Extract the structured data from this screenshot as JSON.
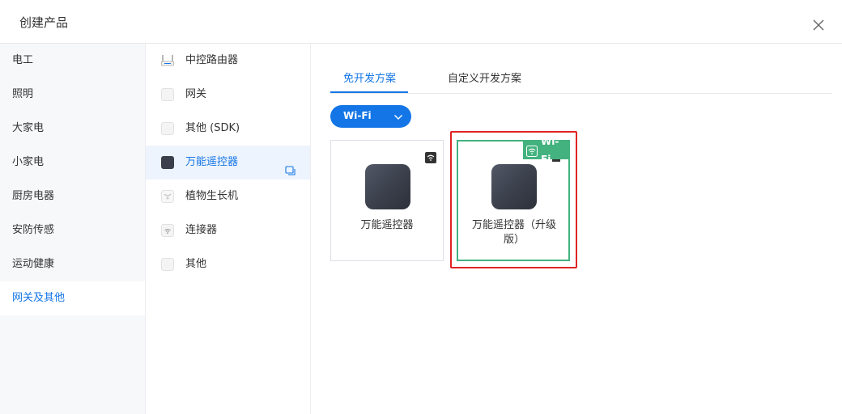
{
  "dialog": {
    "title": "创建产品"
  },
  "categories": [
    {
      "label": "电工"
    },
    {
      "label": "照明"
    },
    {
      "label": "大家电"
    },
    {
      "label": "小家电"
    },
    {
      "label": "厨房电器"
    },
    {
      "label": "安防传感"
    },
    {
      "label": "运动健康"
    },
    {
      "label": "网关及其他",
      "active": true
    }
  ],
  "subcategories": [
    {
      "label": "中控路由器",
      "icon": "router-icon"
    },
    {
      "label": "网关",
      "icon": "gateway-icon"
    },
    {
      "label": "其他 (SDK)",
      "icon": "sdk-device-icon"
    },
    {
      "label": "万能遥控器",
      "icon": "remote-device-icon",
      "active": true
    },
    {
      "label": "植物生长机",
      "icon": "plant-grower-icon"
    },
    {
      "label": "连接器",
      "icon": "connector-icon"
    },
    {
      "label": "其他",
      "icon": "other-device-icon"
    }
  ],
  "tabs": [
    {
      "label": "免开发方案",
      "active": true
    },
    {
      "label": "自定义开发方案"
    }
  ],
  "protocol_select": {
    "value": "Wi-Fi"
  },
  "cards": [
    {
      "label": "万能遥控器"
    },
    {
      "label": "万能遥控器（升级版）",
      "badge": "Wi-Fi",
      "selected": true
    }
  ],
  "colors": {
    "accent": "#1476e6",
    "selected_border": "#43b27f",
    "highlight": "#e02424",
    "device": "#3a3f4b"
  }
}
